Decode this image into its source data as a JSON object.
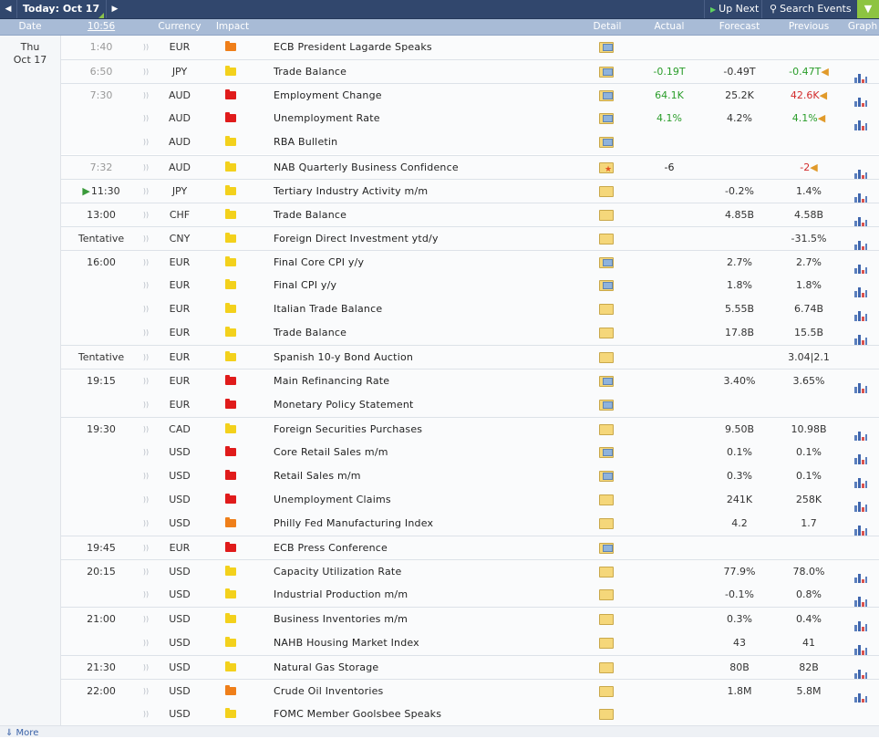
{
  "nav": {
    "today_label": "Today: Oct 17",
    "up_next_label": "Up Next",
    "search_label": "Search Events",
    "prev_glyph": "◀",
    "next_glyph": "▶",
    "filter_glyph": "▼"
  },
  "header": {
    "date": "Date",
    "clock": "10:56",
    "currency": "Currency",
    "impact": "Impact",
    "detail": "Detail",
    "actual": "Actual",
    "forecast": "Forecast",
    "previous": "Previous",
    "graph": "Graph"
  },
  "day": {
    "weekday": "Thu",
    "date": "Oct 17"
  },
  "colors": {
    "nav_bg": "#31476d",
    "header_bg": "#a8bbd6",
    "better": "#2a9d2a",
    "worse": "#d22b2b",
    "high_impact": "#e01b1b",
    "medium_impact": "#ef7f1a",
    "low_impact": "#f3d11c"
  },
  "events": [
    {
      "time": "1:40",
      "past": true,
      "currency": "EUR",
      "impact": "medium",
      "event": "ECB President Lagarde Speaks",
      "detail": "blue",
      "actual": "",
      "forecast": "",
      "previous": "",
      "graph": false
    },
    {
      "time": "6:50",
      "past": true,
      "currency": "JPY",
      "impact": "low",
      "event": "Trade Balance",
      "detail": "blue",
      "actual": "-0.19T",
      "actual_color": "green",
      "forecast": "-0.49T",
      "previous": "-0.47T",
      "previous_color": "green",
      "revised": true,
      "graph": true
    },
    {
      "time": "7:30",
      "past": true,
      "currency": "AUD",
      "impact": "high",
      "event": "Employment Change",
      "detail": "blue",
      "actual": "64.1K",
      "actual_color": "green",
      "forecast": "25.2K",
      "previous": "42.6K",
      "previous_color": "red",
      "revised": true,
      "graph": true
    },
    {
      "time": "",
      "currency": "AUD",
      "impact": "high",
      "event": "Unemployment Rate",
      "detail": "blue",
      "actual": "4.1%",
      "actual_color": "green",
      "forecast": "4.2%",
      "previous": "4.1%",
      "previous_color": "green",
      "revised": true,
      "graph": true
    },
    {
      "time": "",
      "currency": "AUD",
      "impact": "low",
      "event": "RBA Bulletin",
      "detail": "blue",
      "actual": "",
      "forecast": "",
      "previous": "",
      "graph": false
    },
    {
      "time": "7:32",
      "past": true,
      "currency": "AUD",
      "impact": "low",
      "event": "NAB Quarterly Business Confidence",
      "detail": "star",
      "actual": "-6",
      "forecast": "",
      "previous": "-2",
      "previous_color": "red",
      "revised": true,
      "graph": true
    },
    {
      "time": "11:30",
      "upcoming": true,
      "currency": "JPY",
      "impact": "low",
      "event": "Tertiary Industry Activity m/m",
      "detail": "plain",
      "actual": "",
      "forecast": "-0.2%",
      "previous": "1.4%",
      "graph": true
    },
    {
      "time": "13:00",
      "currency": "CHF",
      "impact": "low",
      "event": "Trade Balance",
      "detail": "plain",
      "actual": "",
      "forecast": "4.85B",
      "previous": "4.58B",
      "graph": true
    },
    {
      "time": "Tentative",
      "currency": "CNY",
      "impact": "low",
      "event": "Foreign Direct Investment ytd/y",
      "detail": "plain",
      "actual": "",
      "forecast": "",
      "previous": "-31.5%",
      "graph": true
    },
    {
      "time": "16:00",
      "currency": "EUR",
      "impact": "low",
      "event": "Final Core CPI y/y",
      "detail": "blue",
      "actual": "",
      "forecast": "2.7%",
      "previous": "2.7%",
      "graph": true
    },
    {
      "time": "",
      "currency": "EUR",
      "impact": "low",
      "event": "Final CPI y/y",
      "detail": "blue",
      "actual": "",
      "forecast": "1.8%",
      "previous": "1.8%",
      "graph": true
    },
    {
      "time": "",
      "currency": "EUR",
      "impact": "low",
      "event": "Italian Trade Balance",
      "detail": "plain",
      "actual": "",
      "forecast": "5.55B",
      "previous": "6.74B",
      "graph": true
    },
    {
      "time": "",
      "currency": "EUR",
      "impact": "low",
      "event": "Trade Balance",
      "detail": "plain",
      "actual": "",
      "forecast": "17.8B",
      "previous": "15.5B",
      "graph": true
    },
    {
      "time": "Tentative",
      "currency": "EUR",
      "impact": "low",
      "event": "Spanish 10-y Bond Auction",
      "detail": "plain",
      "actual": "",
      "forecast": "",
      "previous": "3.04|2.1",
      "graph": false
    },
    {
      "time": "19:15",
      "currency": "EUR",
      "impact": "high",
      "event": "Main Refinancing Rate",
      "detail": "blue",
      "actual": "",
      "forecast": "3.40%",
      "previous": "3.65%",
      "graph": true
    },
    {
      "time": "",
      "currency": "EUR",
      "impact": "high",
      "event": "Monetary Policy Statement",
      "detail": "blue",
      "actual": "",
      "forecast": "",
      "previous": "",
      "graph": false
    },
    {
      "time": "19:30",
      "currency": "CAD",
      "impact": "low",
      "event": "Foreign Securities Purchases",
      "detail": "plain",
      "actual": "",
      "forecast": "9.50B",
      "previous": "10.98B",
      "graph": true
    },
    {
      "time": "",
      "currency": "USD",
      "impact": "high",
      "event": "Core Retail Sales m/m",
      "detail": "blue",
      "actual": "",
      "forecast": "0.1%",
      "previous": "0.1%",
      "graph": true
    },
    {
      "time": "",
      "currency": "USD",
      "impact": "high",
      "event": "Retail Sales m/m",
      "detail": "blue",
      "actual": "",
      "forecast": "0.3%",
      "previous": "0.1%",
      "graph": true
    },
    {
      "time": "",
      "currency": "USD",
      "impact": "high",
      "event": "Unemployment Claims",
      "detail": "plain",
      "actual": "",
      "forecast": "241K",
      "previous": "258K",
      "graph": true
    },
    {
      "time": "",
      "currency": "USD",
      "impact": "medium",
      "event": "Philly Fed Manufacturing Index",
      "detail": "plain",
      "actual": "",
      "forecast": "4.2",
      "previous": "1.7",
      "graph": true
    },
    {
      "time": "19:45",
      "currency": "EUR",
      "impact": "high",
      "event": "ECB Press Conference",
      "detail": "blue",
      "actual": "",
      "forecast": "",
      "previous": "",
      "graph": false
    },
    {
      "time": "20:15",
      "currency": "USD",
      "impact": "low",
      "event": "Capacity Utilization Rate",
      "detail": "plain",
      "actual": "",
      "forecast": "77.9%",
      "previous": "78.0%",
      "graph": true
    },
    {
      "time": "",
      "currency": "USD",
      "impact": "low",
      "event": "Industrial Production m/m",
      "detail": "plain",
      "actual": "",
      "forecast": "-0.1%",
      "previous": "0.8%",
      "graph": true
    },
    {
      "time": "21:00",
      "currency": "USD",
      "impact": "low",
      "event": "Business Inventories m/m",
      "detail": "plain",
      "actual": "",
      "forecast": "0.3%",
      "previous": "0.4%",
      "graph": true
    },
    {
      "time": "",
      "currency": "USD",
      "impact": "low",
      "event": "NAHB Housing Market Index",
      "detail": "plain",
      "actual": "",
      "forecast": "43",
      "previous": "41",
      "graph": true
    },
    {
      "time": "21:30",
      "currency": "USD",
      "impact": "low",
      "event": "Natural Gas Storage",
      "detail": "plain",
      "actual": "",
      "forecast": "80B",
      "previous": "82B",
      "graph": true
    },
    {
      "time": "22:00",
      "currency": "USD",
      "impact": "medium",
      "event": "Crude Oil Inventories",
      "detail": "plain",
      "actual": "",
      "forecast": "1.8M",
      "previous": "5.8M",
      "graph": true
    },
    {
      "time": "",
      "currency": "USD",
      "impact": "low",
      "event": "FOMC Member Goolsbee Speaks",
      "detail": "plain",
      "actual": "",
      "forecast": "",
      "previous": "",
      "graph": false
    }
  ],
  "footer": {
    "more_label": "⇓ More"
  }
}
